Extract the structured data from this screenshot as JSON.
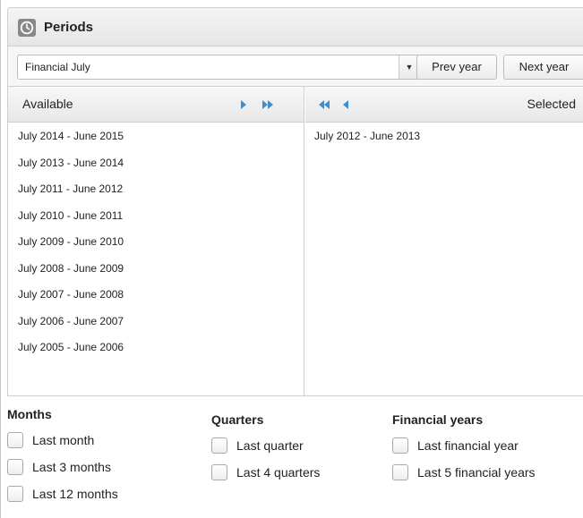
{
  "panel": {
    "title": "Periods",
    "icon": "clock-icon"
  },
  "toolbar": {
    "period_type": {
      "value": "Financial July"
    },
    "prev_label": "Prev year",
    "next_label": "Next year"
  },
  "available": {
    "header": "Available",
    "items": [
      "July 2014 - June 2015",
      "July 2013 - June 2014",
      "July 2011 - June 2012",
      "July 2010 - June 2011",
      "July 2009 - June 2010",
      "July 2008 - June 2009",
      "July 2007 - June 2008",
      "July 2006 - June 2007",
      "July 2005 - June 2006"
    ]
  },
  "selected": {
    "header": "Selected",
    "items": [
      "July 2012 - June 2013"
    ]
  },
  "groups": {
    "months": {
      "title": "Months",
      "options": [
        "Last month",
        "Last 3 months",
        "Last 12 months"
      ]
    },
    "quarters": {
      "title": "Quarters",
      "options": [
        "Last quarter",
        "Last 4 quarters"
      ]
    },
    "financial": {
      "title": "Financial years",
      "options": [
        "Last financial year",
        "Last 5 financial years"
      ]
    }
  },
  "colors": {
    "accent_arrow": "#3b8fd6",
    "panel_border": "#cfcfcf"
  }
}
